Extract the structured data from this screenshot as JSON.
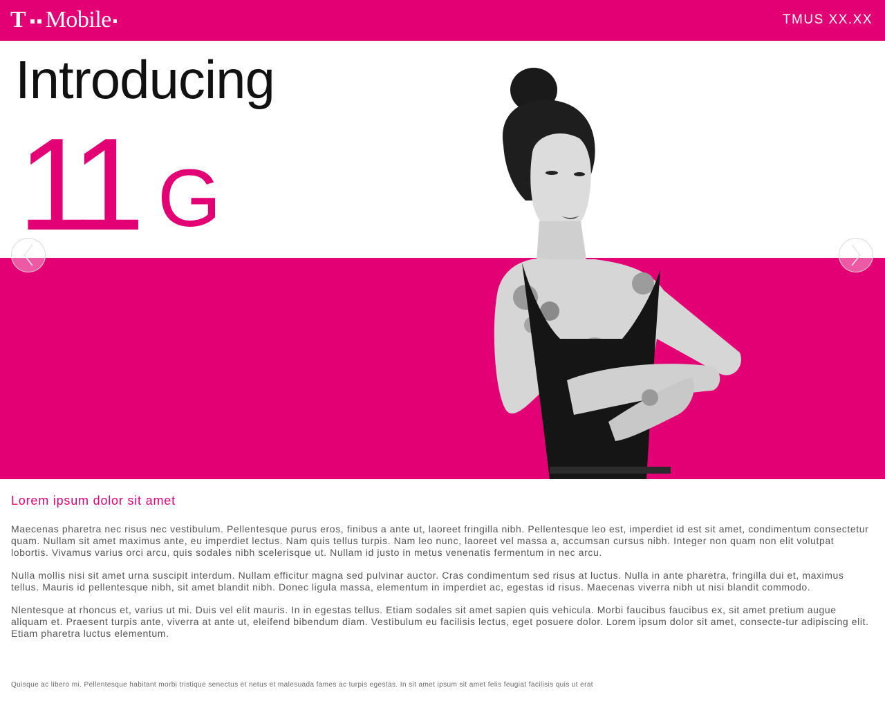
{
  "header": {
    "brand_t": "T",
    "brand_word": "Mobile",
    "ticker": "TMUS XX.XX"
  },
  "hero": {
    "intro": "Introducing",
    "number": "11",
    "suffix": "G"
  },
  "content": {
    "headline": "Lorem ipsum dolor sit amet",
    "paragraphs": [
      "Maecenas pharetra nec risus nec vestibulum. Pellentesque purus eros, finibus a ante ut, laoreet fringilla nibh. Pellentesque leo est, imperdiet id est sit amet, condimentum consectetur quam. Nullam sit amet maximus ante, eu imperdiet lectus. Nam quis tellus turpis. Nam leo nunc, laoreet vel massa a, accumsan cursus nibh. Integer non quam non elit volutpat lobortis. Vivamus varius orci arcu, quis sodales nibh scelerisque ut. Nullam id justo in metus venenatis fermentum in nec arcu.",
      "Nulla mollis nisi sit amet urna suscipit interdum. Nullam efficitur magna sed pulvinar auctor. Cras condimentum sed risus at luctus. Nulla in ante pharetra, fringilla dui et, maximus tellus. Mauris id pellentesque nibh, sit amet blandit nibh. Donec ligula massa, elementum in imperdiet ac, egestas id risus. Maecenas viverra nibh ut nisi blandit commodo.",
      "Nlentesque at rhoncus et, varius ut mi. Duis vel elit mauris. In in egestas tellus. Etiam sodales sit amet sapien quis vehicula. Morbi faucibus faucibus ex, sit amet pretium augue aliquam et. Praesent turpis ante, viverra at ante ut, eleifend bibendum diam. Vestibulum eu facilisis lectus, eget posuere dolor. Lorem ipsum dolor sit amet, consecte-tur adipiscing elit. Etiam pharetra luctus elementum."
    ]
  },
  "footer": {
    "text": "Quisque ac libero mi. Pellentesque habitant morbi tristique senectus et netus et malesuada fames ac turpis egestas. In sit amet ipsum sit amet felis feugiat facilisis quis ut erat"
  },
  "icons": {
    "prev": "chevron-left-icon",
    "next": "chevron-right-icon"
  },
  "colors": {
    "brand": "#e20074",
    "background": "#ffffff"
  }
}
